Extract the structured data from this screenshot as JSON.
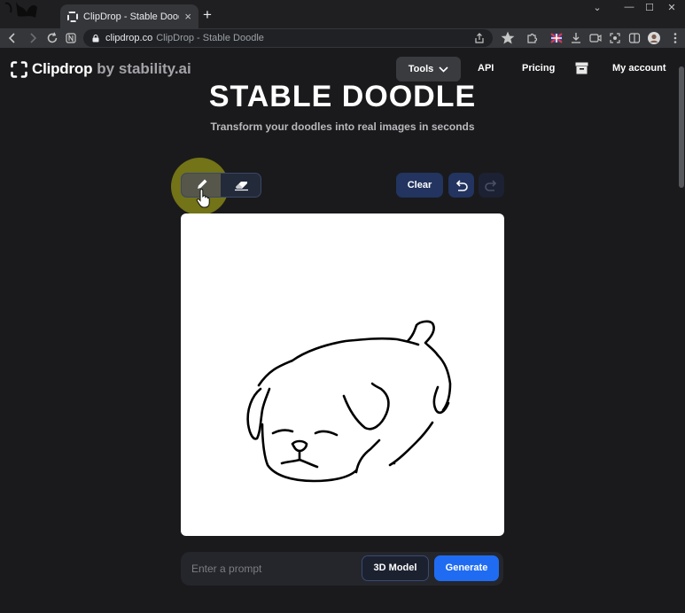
{
  "browser": {
    "tab_title": "ClipDrop - Stable Doodle",
    "tab_close": "×",
    "new_tab": "+",
    "url_domain": "clipdrop.co",
    "url_title": "ClipDrop - Stable Doodle",
    "window_controls": [
      "⌄",
      "—",
      "☐",
      "✕"
    ]
  },
  "nav": {
    "brand": "Clipdrop",
    "brand_suffix": "by stability.ai",
    "tools_label": "Tools",
    "api_label": "API",
    "pricing_label": "Pricing",
    "account_label": "My account"
  },
  "hero": {
    "title": "STABLE DOODLE",
    "subtitle": "Transform your doodles into real images in seconds"
  },
  "controls": {
    "clear_label": "Clear"
  },
  "prompt": {
    "placeholder": "Enter a prompt",
    "value": "",
    "style_label": "3D Model",
    "generate_label": "Generate"
  },
  "colors": {
    "accent": "#1f6cf2",
    "button_dark_blue": "#22345f",
    "page_bg": "#1a1a1c"
  }
}
